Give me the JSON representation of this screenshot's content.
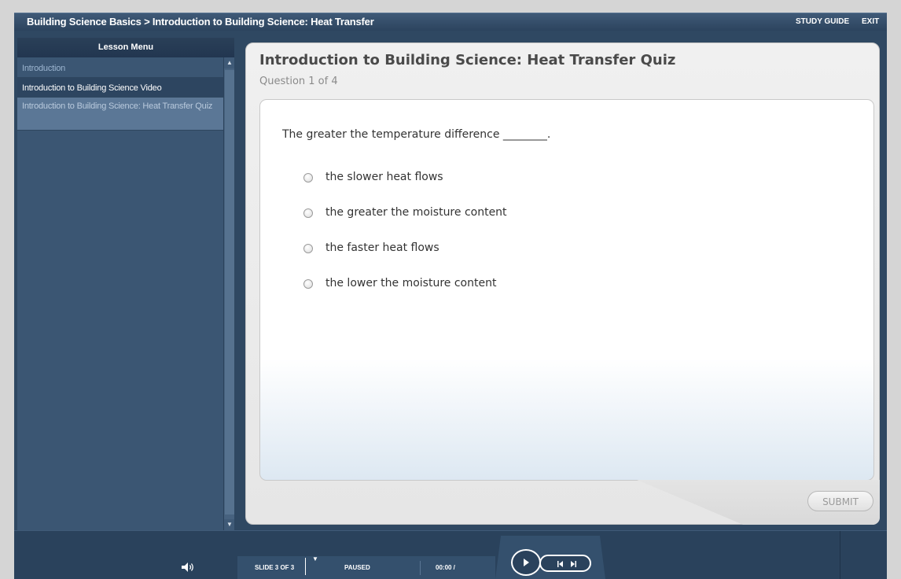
{
  "titlebar": {
    "course_title": "Building Science Basics > Introduction to Building Science: Heat Transfer",
    "study_guide": "STUDY GUIDE",
    "exit": "EXIT"
  },
  "sidebar": {
    "header": "Lesson Menu",
    "items": [
      {
        "label": "Introduction",
        "state": "visited"
      },
      {
        "label": "Introduction to Building Science Video",
        "state": "current-chapter"
      },
      {
        "label": "Introduction to Building Science: Heat Transfer Quiz",
        "state": "selected"
      }
    ]
  },
  "quiz": {
    "title": "Introduction to Building Science: Heat Transfer Quiz",
    "progress": "Question 1 of 4",
    "question": "The greater the temperature difference ________.",
    "choices": [
      "the slower heat flows",
      "the greater the moisture content",
      "the faster heat flows",
      "the lower the moisture content"
    ],
    "submit": "SUBMIT"
  },
  "controls": {
    "slide_counter": "SLIDE 3 OF 3",
    "play_status": "PAUSED",
    "elapsed_time": "00:00 /",
    "icons": [
      "volume-icon",
      "play-icon",
      "rewind-icon",
      "forward-icon"
    ]
  },
  "colors": {
    "frame": "#2f4862",
    "sidebar": "#3b5673",
    "selected_item": "#5b7796",
    "panel": "#ececec",
    "text": "#333333"
  }
}
